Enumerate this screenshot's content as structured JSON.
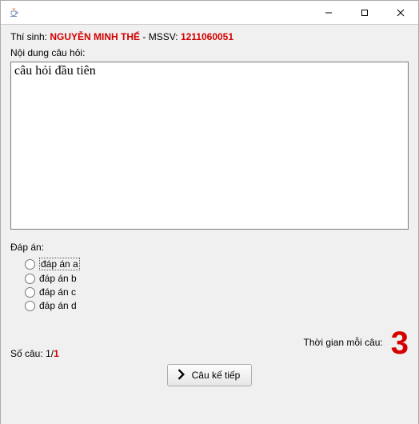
{
  "window": {
    "title": ""
  },
  "student": {
    "prefix": "Thí sinh: ",
    "name": "NGUYỄN MINH THẾ",
    "mssv_label": " - MSSV: ",
    "mssv": "1211060051"
  },
  "question": {
    "heading": "Nội dung câu hỏi:",
    "content": "câu hỏi đầu tiên"
  },
  "answers": {
    "heading": "Đáp án:",
    "options": [
      {
        "label": "đáp án a"
      },
      {
        "label": "đáp án b"
      },
      {
        "label": "đáp án c"
      },
      {
        "label": "đáp án d"
      }
    ]
  },
  "footer": {
    "count_label": "Số câu: ",
    "current": "1",
    "sep": "/",
    "total": "1",
    "time_label": "Thời gian mỗi câu:",
    "countdown": "3",
    "next_button": "Câu kế tiếp"
  },
  "colors": {
    "accent_red": "#d40000",
    "panel_bg": "#f0f0f0"
  }
}
